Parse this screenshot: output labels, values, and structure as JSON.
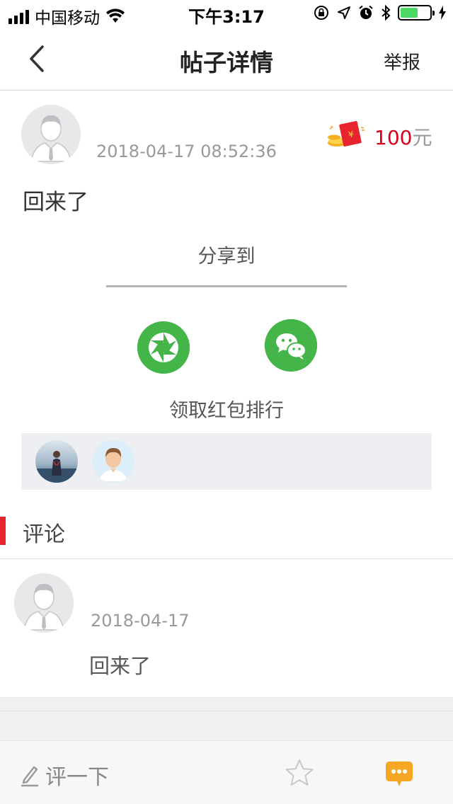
{
  "status_bar": {
    "carrier": "中国移动",
    "time": "下午3:17"
  },
  "nav": {
    "title": "帖子详情",
    "report_label": "举报"
  },
  "post": {
    "timestamp": "2018-04-17 08:52:36",
    "reward_amount": "100",
    "reward_unit": "元",
    "content": "回来了"
  },
  "share": {
    "title": "分享到",
    "targets": [
      "moments-icon",
      "wechat-icon"
    ]
  },
  "ranking": {
    "title": "领取红包排行"
  },
  "comments": {
    "header": "评论",
    "items": [
      {
        "date": "2018-04-17",
        "text": "回来了"
      }
    ]
  },
  "bottom_bar": {
    "comment_placeholder": "评一下"
  },
  "colors": {
    "accent_red": "#e8242e",
    "amount_red": "#d9001b",
    "share_green": "#44b549",
    "chat_orange": "#f5a623"
  }
}
